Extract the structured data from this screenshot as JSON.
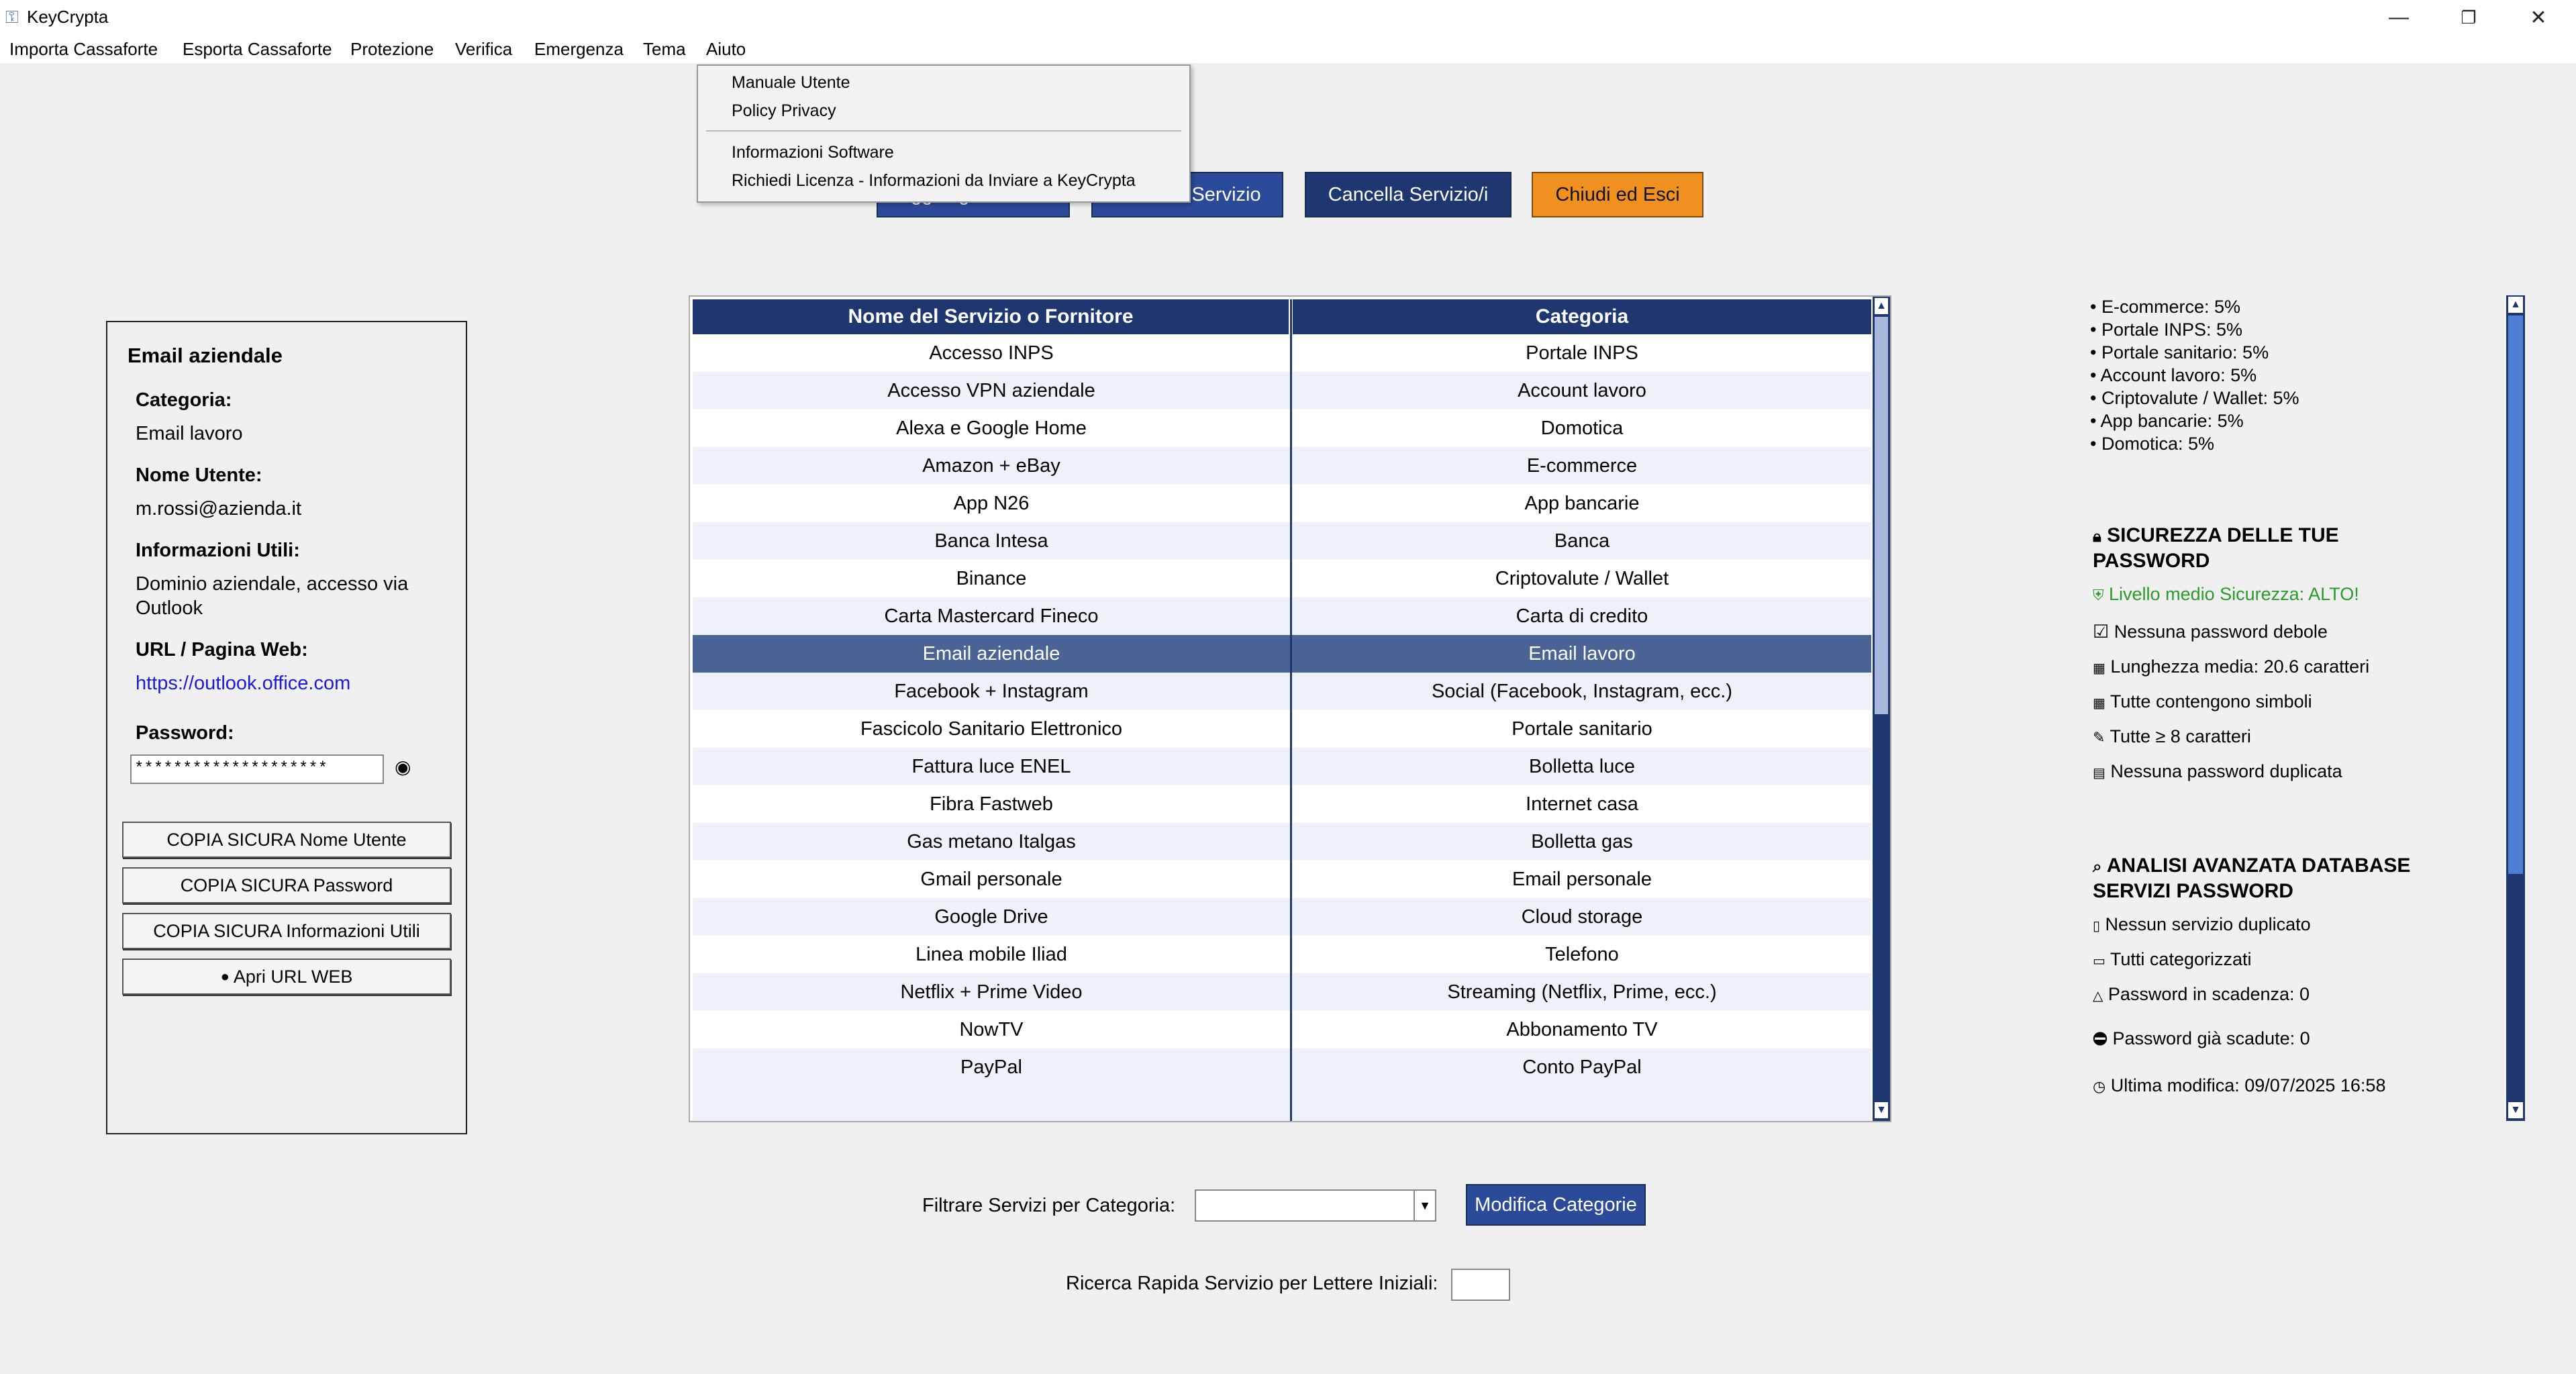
{
  "window": {
    "title": "KeyCrypta",
    "controls": {
      "minimize": "—",
      "maximize": "❐",
      "close": "✕"
    }
  },
  "menu": {
    "items": [
      "Importa Cassaforte",
      "Esporta Cassaforte",
      "Protezione",
      "Verifica",
      "Emergenza",
      "Tema",
      "Aiuto"
    ],
    "open_menu": "Aiuto",
    "dropdown": [
      "Manuale Utente",
      "Policy Privacy",
      "Informazioni Software",
      "Richiedi Licenza - Informazioni da Inviare a KeyCrypta"
    ]
  },
  "toolbar": {
    "add": "Aggiungi Servizio",
    "edit": "Modifica Servizio",
    "delete": "Cancella Servizio/i",
    "exit": "Chiudi ed Esci"
  },
  "detail": {
    "title": "Email aziendale",
    "category_label": "Categoria:",
    "category_value": "Email lavoro",
    "username_label": "Nome Utente:",
    "username_value": "m.rossi@azienda.it",
    "info_label": "Informazioni Utili:",
    "info_value_1": "Dominio aziendale, accesso via",
    "info_value_2": "Outlook",
    "url_label": "URL / Pagina Web:",
    "url_value": "https://outlook.office.com",
    "password_label": "Password:",
    "password_value": "********************",
    "copy_username": "COPIA SICURA Nome Utente",
    "copy_password": "COPIA SICURA Password",
    "copy_info": "COPIA SICURA Informazioni Utili",
    "open_url": "Apri URL WEB"
  },
  "table": {
    "headers": [
      "Nome del Servizio o Fornitore",
      "Categoria"
    ],
    "selected_index": 8,
    "rows": [
      [
        "Accesso INPS",
        "Portale INPS"
      ],
      [
        "Accesso VPN aziendale",
        "Account lavoro"
      ],
      [
        "Alexa e Google Home",
        "Domotica"
      ],
      [
        "Amazon + eBay",
        "E-commerce"
      ],
      [
        "App N26",
        "App bancarie"
      ],
      [
        "Banca Intesa",
        "Banca"
      ],
      [
        "Binance",
        "Criptovalute / Wallet"
      ],
      [
        "Carta Mastercard Fineco",
        "Carta di credito"
      ],
      [
        "Email aziendale",
        "Email lavoro"
      ],
      [
        "Facebook + Instagram",
        "Social (Facebook, Instagram, ecc.)"
      ],
      [
        "Fascicolo Sanitario Elettronico",
        "Portale sanitario"
      ],
      [
        "Fattura luce ENEL",
        "Bolletta luce"
      ],
      [
        "Fibra Fastweb",
        "Internet casa"
      ],
      [
        "Gas metano Italgas",
        "Bolletta gas"
      ],
      [
        "Gmail personale",
        "Email personale"
      ],
      [
        "Google Drive",
        "Cloud storage"
      ],
      [
        "Linea mobile Iliad",
        "Telefono"
      ],
      [
        "Netflix + Prime Video",
        "Streaming (Netflix, Prime, ecc.)"
      ],
      [
        "NowTV",
        "Abbonamento TV"
      ],
      [
        "PayPal",
        "Conto PayPal"
      ]
    ]
  },
  "stats": {
    "categories": [
      "• E-commerce: 5%",
      "• Portale INPS: 5%",
      "• Portale sanitario: 5%",
      "• Account lavoro: 5%",
      "• Criptovalute / Wallet: 5%",
      "• App bancarie: 5%",
      "• Domotica: 5%"
    ],
    "security_title_1": "SICUREZZA DELLE TUE",
    "security_title_2": "PASSWORD",
    "security_level": "Livello medio Sicurezza: ALTO!",
    "security_items": [
      "Nessuna password debole",
      "Lunghezza media: 20.6 caratteri",
      "Tutte contengono simboli",
      "Tutte ≥ 8 caratteri",
      "Nessuna password duplicata"
    ],
    "analysis_title_1": "ANALISI AVANZATA DATABASE",
    "analysis_title_2": "SERVIZI PASSWORD",
    "analysis_items": [
      "Nessun servizio duplicato",
      "Tutti categorizzati",
      "Password in scadenza: 0",
      "Password già scadute: 0",
      "Ultima modifica: 09/07/2025 16:58"
    ]
  },
  "filter": {
    "label": "Filtrare Servizi per Categoria:",
    "value": "",
    "edit_categories": "Modifica Categorie"
  },
  "search": {
    "label": "Ricerca Rapida Servizio per Lettere Iniziali:",
    "value": ""
  },
  "colors": {
    "navy": "#1e3770",
    "blue_button": "#2c4a9a",
    "orange_button": "#f0901e",
    "selected_row": "#4a6495",
    "link": "#1a1adc",
    "green": "#2a9a2a"
  }
}
